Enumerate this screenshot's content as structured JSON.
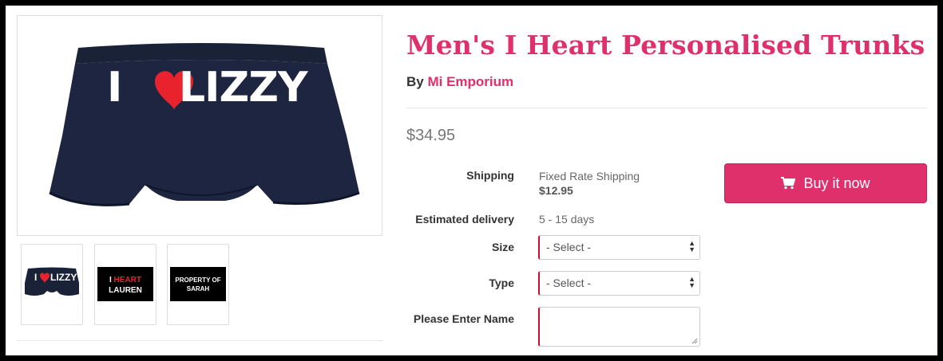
{
  "product": {
    "title": "Men's I Heart Personalised Trunks",
    "by_prefix": "By",
    "seller": "Mi Emporium",
    "price": "$34.95"
  },
  "main_image": {
    "text_i": "I",
    "text_name": "LIZZY"
  },
  "thumbnails": [
    {
      "text_i": "I",
      "text_name": "LIZZY"
    },
    {
      "line1_i": "I",
      "line1_heart": "HEART",
      "line2": "LAUREN"
    },
    {
      "line1": "PROPERTY OF",
      "line2": "SARAH"
    }
  ],
  "shipping": {
    "label": "Shipping",
    "method": "Fixed Rate Shipping",
    "cost": "$12.95"
  },
  "delivery": {
    "label": "Estimated delivery",
    "value": "5 - 15 days"
  },
  "size": {
    "label": "Size",
    "selected": "- Select -"
  },
  "type": {
    "label": "Type",
    "selected": "- Select -"
  },
  "name_field": {
    "label": "Please Enter Name",
    "value": ""
  },
  "buy_button": {
    "label": "Buy it now",
    "icon": "cart-icon"
  },
  "colors": {
    "accent": "#e0306c",
    "trunks": "#1a2238",
    "heart": "#e8232e"
  }
}
